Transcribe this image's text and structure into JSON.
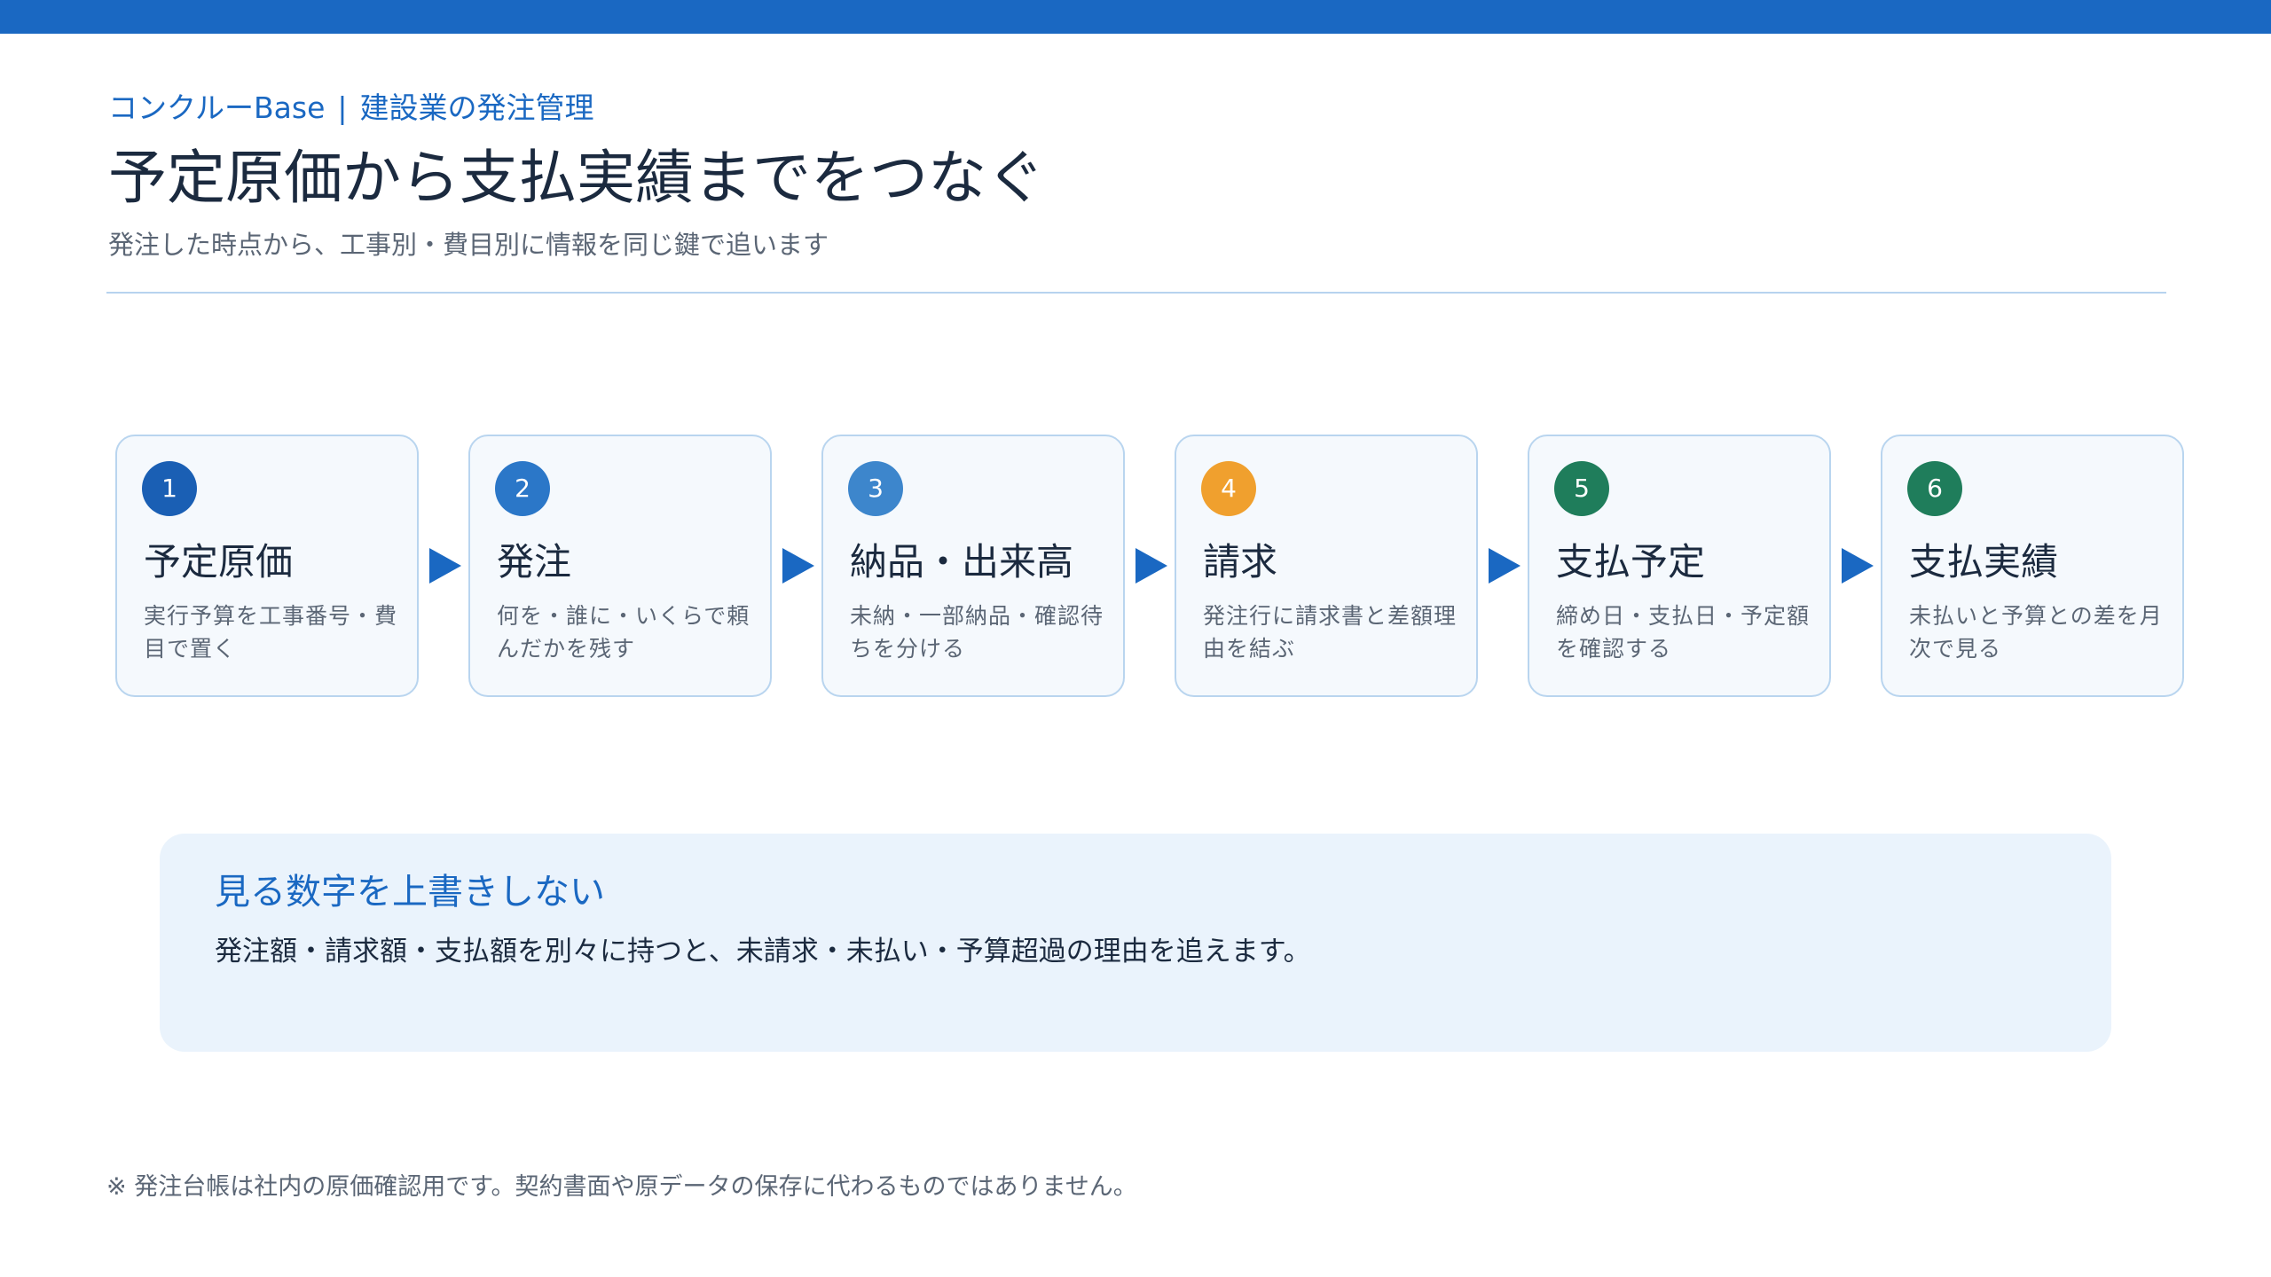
{
  "header": {
    "product": "コンクルーBase",
    "separator": "|",
    "section": "建設業の発注管理",
    "title": "予定原価から支払実績までをつなぐ",
    "subtitle": "発注した時点から、工事別・費目別に情報を同じ鍵で追います"
  },
  "colors": {
    "accent": "#1a68c2",
    "step_blue_dark": "#1a5fb4",
    "step_blue": "#2b77c8",
    "step_blue_light": "#3d86cc",
    "step_orange": "#f0a02e",
    "step_green": "#1f7d5b"
  },
  "steps": [
    {
      "number": "1",
      "title": "予定原価",
      "description": "実行予算を工事番号・費目で置く",
      "color": "#1a5fb4"
    },
    {
      "number": "2",
      "title": "発注",
      "description": "何を・誰に・いくらで頼んだかを残す",
      "color": "#2b77c8"
    },
    {
      "number": "3",
      "title": "納品・出来高",
      "description": "未納・一部納品・確認待ちを分ける",
      "color": "#3d86cc"
    },
    {
      "number": "4",
      "title": "請求",
      "description": "発注行に請求書と差額理由を結ぶ",
      "color": "#f0a02e"
    },
    {
      "number": "5",
      "title": "支払予定",
      "description": "締め日・支払日・予定額を確認する",
      "color": "#1f7d5b"
    },
    {
      "number": "6",
      "title": "支払実績",
      "description": "未払いと予算との差を月次で見る",
      "color": "#1f7d5b"
    }
  ],
  "callout": {
    "title": "見る数字を上書きしない",
    "body": "発注額・請求額・支払額を別々に持つと、未請求・未払い・予算超過の理由を追えます。"
  },
  "footnote": "※ 発注台帳は社内の原価確認用です。契約書面や原データの保存に代わるものではありません。"
}
